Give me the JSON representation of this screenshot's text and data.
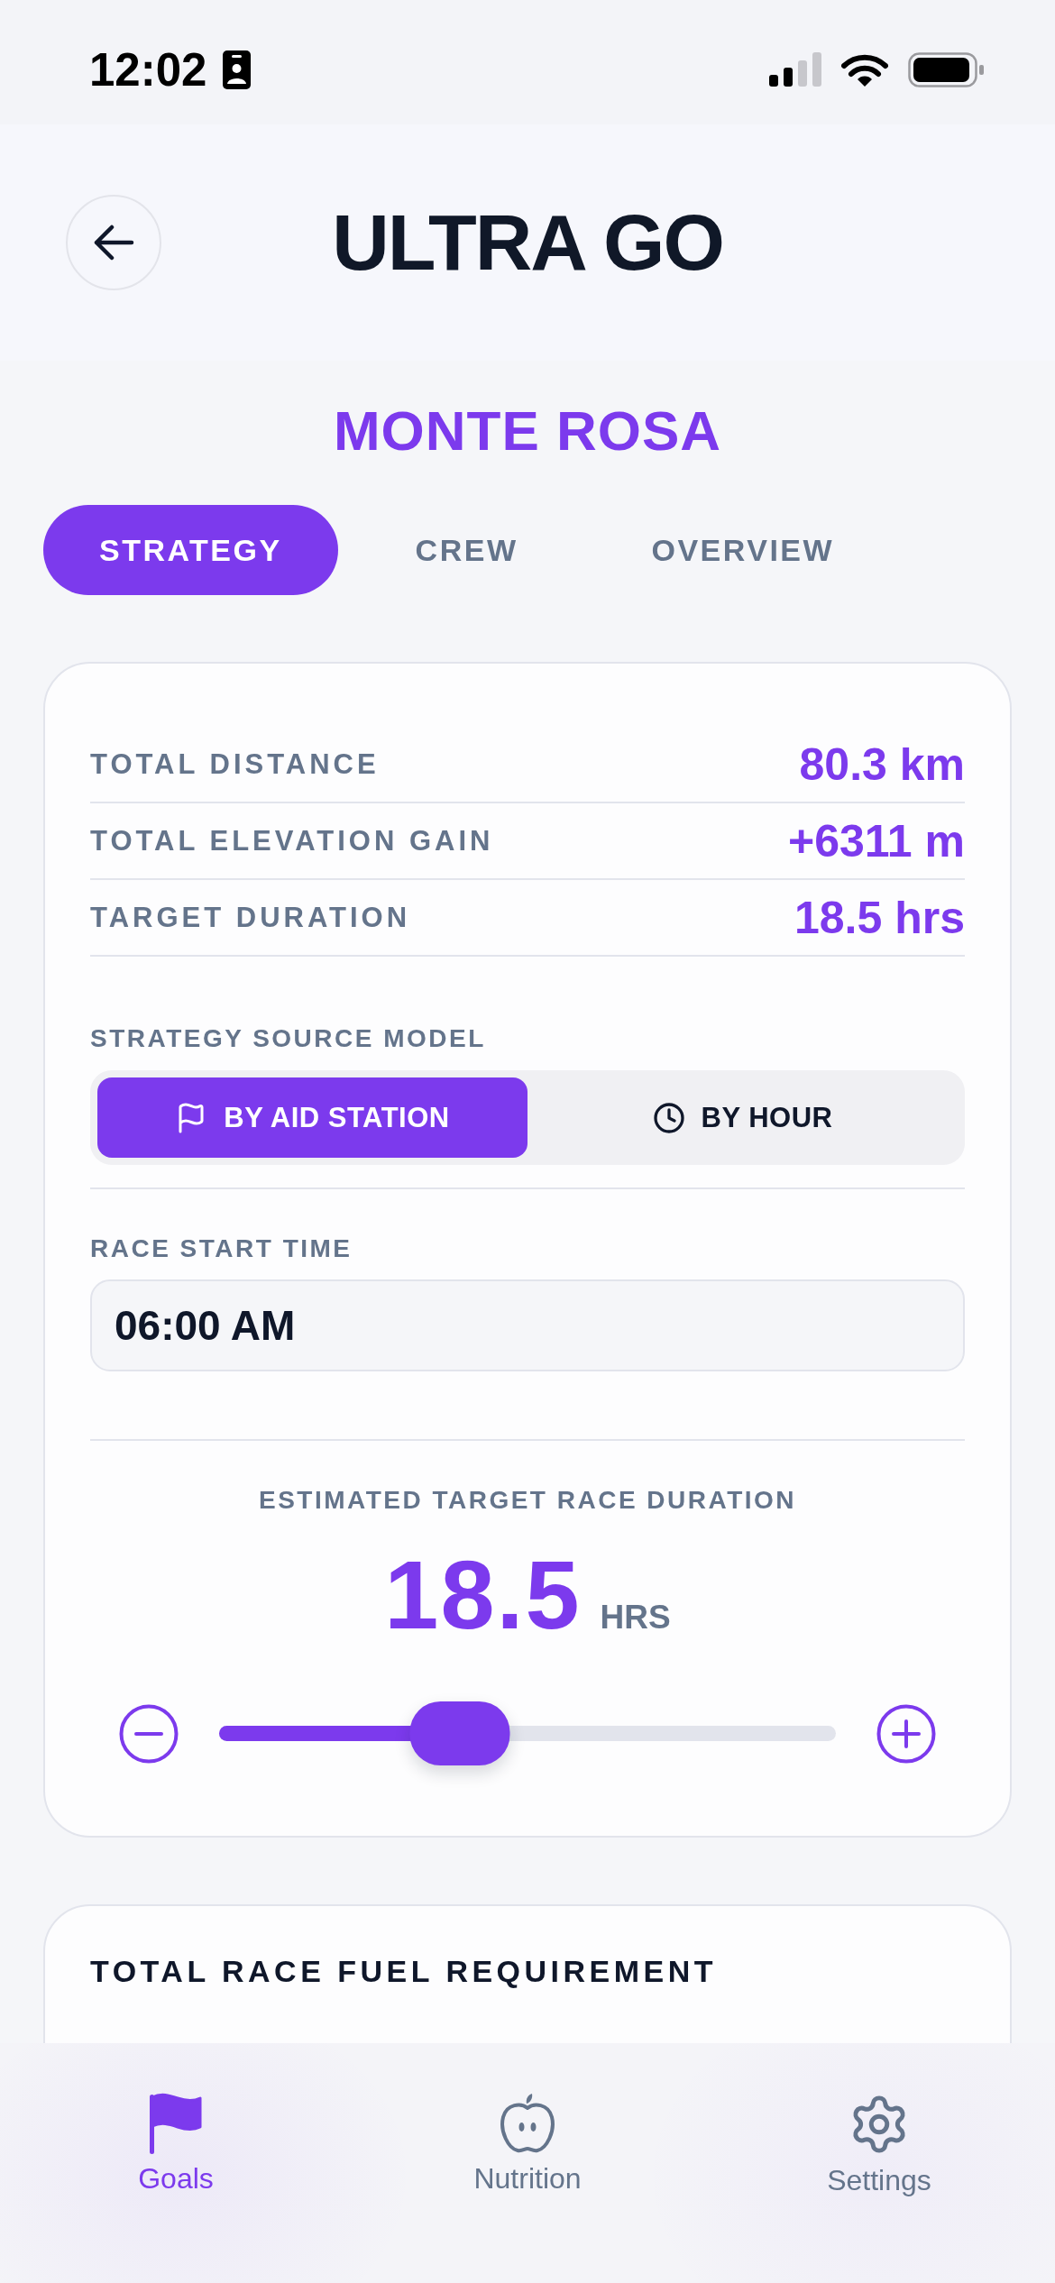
{
  "status_bar": {
    "time": "12:02"
  },
  "header": {
    "title": "ULTRA GO"
  },
  "race": {
    "name": "MONTE ROSA"
  },
  "tabs": [
    {
      "label": "STRATEGY",
      "selected": true
    },
    {
      "label": "CREW",
      "selected": false
    },
    {
      "label": "OVERVIEW",
      "selected": false
    }
  ],
  "strategy_card": {
    "stats": [
      {
        "label": "TOTAL DISTANCE",
        "value": "80.3 km"
      },
      {
        "label": "TOTAL ELEVATION GAIN",
        "value": "+6311 m"
      },
      {
        "label": "TARGET DURATION",
        "value": "18.5 hrs"
      }
    ],
    "source_model": {
      "label": "STRATEGY SOURCE MODEL",
      "options": [
        {
          "label": "BY AID STATION",
          "kind": "flag",
          "selected": true
        },
        {
          "label": "BY HOUR",
          "kind": "clock",
          "selected": false
        }
      ]
    },
    "start_time": {
      "label": "RACE START TIME",
      "value": "06:00 AM"
    },
    "duration": {
      "label": "ESTIMATED TARGET RACE DURATION",
      "value": "18.5",
      "unit": "HRS",
      "level": 0.39
    }
  },
  "fuel_card": {
    "title": "TOTAL RACE FUEL REQUIREMENT"
  },
  "nav": [
    {
      "label": "Goals",
      "kind": "flag",
      "selected": true
    },
    {
      "label": "Nutrition",
      "kind": "apple",
      "selected": false
    },
    {
      "label": "Settings",
      "kind": "gear",
      "selected": false
    }
  ]
}
